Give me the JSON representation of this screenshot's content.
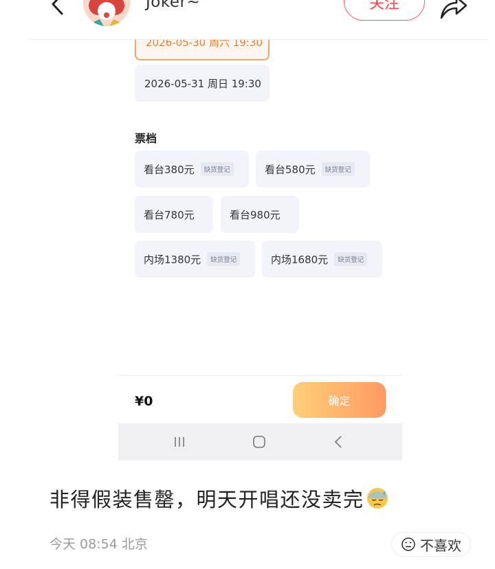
{
  "header": {
    "username": "Joker~",
    "follow_label": "关注"
  },
  "embedded_screenshot": {
    "dates": [
      {
        "label": "2026-05-30 周六 19:30",
        "selected": true
      },
      {
        "label": "2026-05-31 周日 19:30",
        "selected": false
      }
    ],
    "ticket_section_title": "票档",
    "tickets": [
      {
        "label": "看台380元",
        "tag": "缺货登记"
      },
      {
        "label": "看台580元",
        "tag": "缺货登记"
      },
      {
        "label": "看台780元",
        "tag": ""
      },
      {
        "label": "看台980元",
        "tag": ""
      },
      {
        "label": "内场1380元",
        "tag": "缺货登记"
      },
      {
        "label": "内场1680元",
        "tag": "缺货登记"
      }
    ],
    "price": "¥0",
    "confirm_label": "确定"
  },
  "post": {
    "text": "非得假装售罄，明天开唱还没卖完",
    "emoji": "downcast-face-with-sweat",
    "meta": "今天 08:54 北京",
    "dislike_label": "不喜欢"
  },
  "colors": {
    "follow": "#ff4a52",
    "selected_date": "#e8812f",
    "confirm_gradient_start": "#ffcf7a",
    "confirm_gradient_end": "#ff9a62"
  }
}
